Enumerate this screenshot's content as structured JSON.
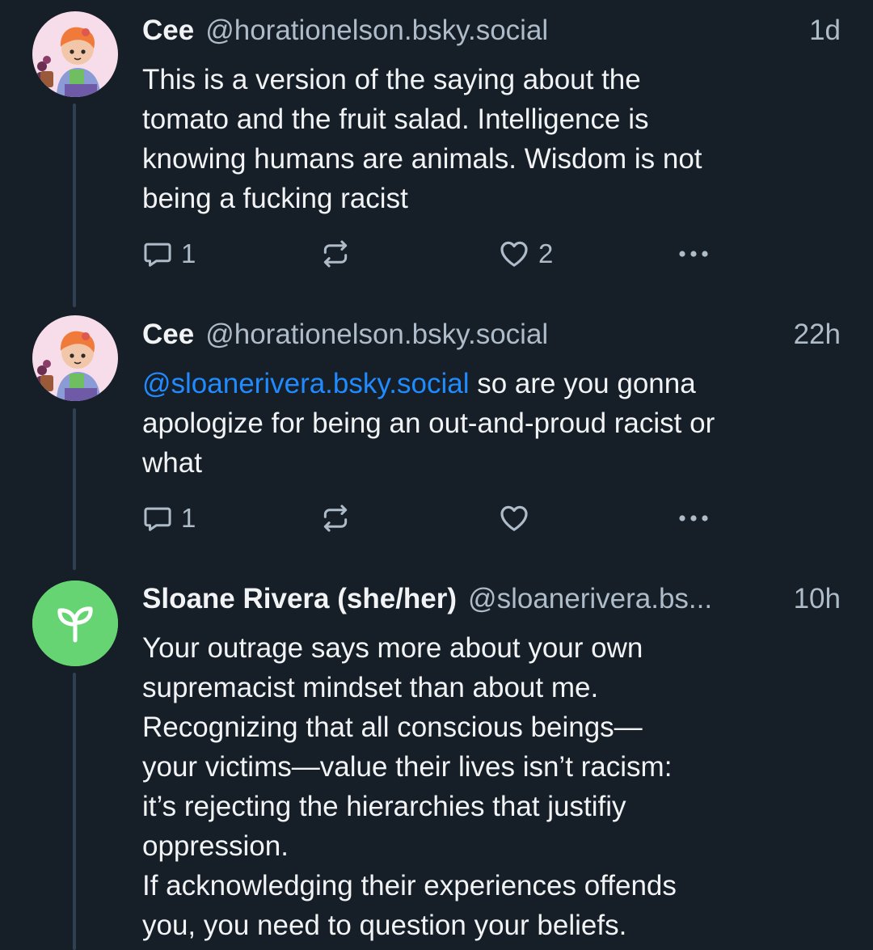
{
  "colors": {
    "background": "#161e27",
    "text_primary": "#f1f3f5",
    "text_secondary": "#aebbc9",
    "mention": "#208bfe",
    "thread_line": "#2e4052",
    "sloane_avatar_bg": "#67d473"
  },
  "posts": [
    {
      "display_name": "Cee",
      "handle": "@horationelson.bsky.social",
      "time": "1d",
      "text": "This is a version of the saying about the\ntomato and the fruit salad. Intelligence is\nknowing humans are animals. Wisdom is not\nbeing a fucking racist",
      "reply_count": "1",
      "repost_count": "",
      "like_count": "2",
      "icons": [
        "reply-icon",
        "repost-icon",
        "heart-icon",
        "more-icon"
      ]
    },
    {
      "display_name": "Cee",
      "handle": "@horationelson.bsky.social",
      "time": "22h",
      "mention": "@sloanerivera.bsky.social",
      "text": " so are you gonna\napologize for being an out-and-proud racist or\nwhat",
      "reply_count": "1",
      "repost_count": "",
      "like_count": "",
      "icons": [
        "reply-icon",
        "repost-icon",
        "heart-icon",
        "more-icon"
      ]
    },
    {
      "display_name": "Sloane Rivera (she/her)",
      "handle": "@sloanerivera.bs...",
      "time": "10h",
      "text": "Your outrage says more about your own\nsupremacist mindset than about me.\nRecognizing that all conscious beings—\nyour victims—value their lives isn’t racism:\nit’s rejecting the hierarchies that justifiy\noppression.\nIf acknowledging their experiences offends\nyou, you need to question your beliefs.",
      "avatar_icon": "seedling-icon"
    }
  ]
}
